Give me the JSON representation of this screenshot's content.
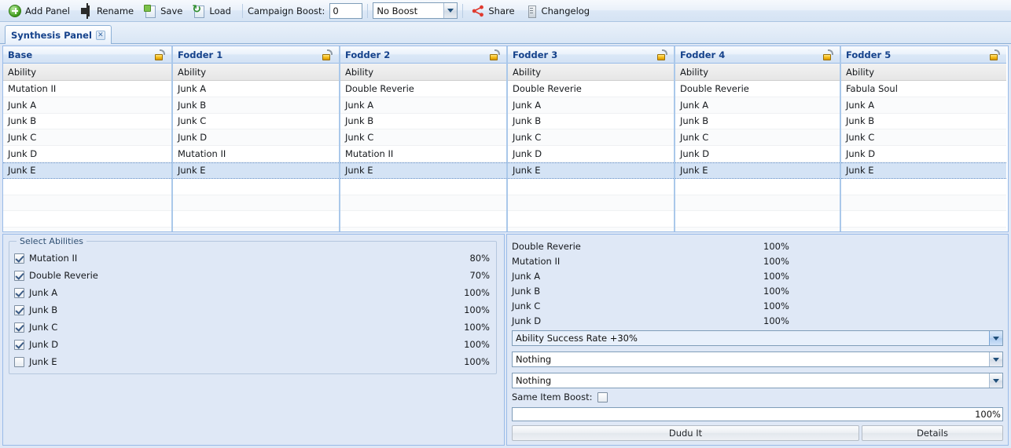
{
  "toolbar": {
    "add_panel": "Add Panel",
    "rename": "Rename",
    "save": "Save",
    "load": "Load",
    "campaign_boost_label": "Campaign Boost:",
    "campaign_boost_value": "0",
    "boost_select_value": "No Boost",
    "share": "Share",
    "changelog": "Changelog"
  },
  "tabs": [
    {
      "label": "Synthesis Panel",
      "close": "✕"
    }
  ],
  "grid": {
    "sub_header": "Ability",
    "columns": [
      {
        "title": "Base",
        "lock": "unlocked-padlock-icon",
        "rows": [
          "Mutation II",
          "Junk A",
          "Junk B",
          "Junk C",
          "Junk D",
          "Junk E"
        ],
        "selected_index": 5
      },
      {
        "title": "Fodder 1",
        "lock": "unlocked-padlock-icon",
        "rows": [
          "Junk A",
          "Junk B",
          "Junk C",
          "Junk D",
          "Mutation II",
          "Junk E"
        ],
        "selected_index": 5
      },
      {
        "title": "Fodder 2",
        "lock": "unlocked-padlock-icon",
        "rows": [
          "Double Reverie",
          "Junk A",
          "Junk B",
          "Junk C",
          "Mutation II",
          "Junk E"
        ],
        "selected_index": 5
      },
      {
        "title": "Fodder 3",
        "lock": "unlocked-padlock-icon",
        "rows": [
          "Double Reverie",
          "Junk A",
          "Junk B",
          "Junk C",
          "Junk D",
          "Junk E"
        ],
        "selected_index": 5
      },
      {
        "title": "Fodder 4",
        "lock": "unlocked-padlock-icon",
        "rows": [
          "Double Reverie",
          "Junk A",
          "Junk B",
          "Junk C",
          "Junk D",
          "Junk E"
        ],
        "selected_index": 5
      },
      {
        "title": "Fodder 5",
        "lock": "unlocked-padlock-icon",
        "rows": [
          "Fabula Soul",
          "Junk A",
          "Junk B",
          "Junk C",
          "Junk D",
          "Junk E"
        ],
        "selected_index": 5
      }
    ],
    "empty_rows": 4
  },
  "select_abilities": {
    "legend": "Select Abilities",
    "items": [
      {
        "name": "Mutation II",
        "checked": true,
        "percent": "80%"
      },
      {
        "name": "Double Reverie",
        "checked": true,
        "percent": "70%"
      },
      {
        "name": "Junk A",
        "checked": true,
        "percent": "100%"
      },
      {
        "name": "Junk B",
        "checked": true,
        "percent": "100%"
      },
      {
        "name": "Junk C",
        "checked": true,
        "percent": "100%"
      },
      {
        "name": "Junk D",
        "checked": true,
        "percent": "100%"
      },
      {
        "name": "Junk E",
        "checked": false,
        "percent": "100%"
      }
    ]
  },
  "results": {
    "rows": [
      {
        "name": "Double Reverie",
        "percent": "100%"
      },
      {
        "name": "Mutation II",
        "percent": "100%"
      },
      {
        "name": "Junk A",
        "percent": "100%"
      },
      {
        "name": "Junk B",
        "percent": "100%"
      },
      {
        "name": "Junk C",
        "percent": "100%"
      },
      {
        "name": "Junk D",
        "percent": "100%"
      }
    ],
    "combos": [
      {
        "value": "Ability Success Rate +30%",
        "focused": true
      },
      {
        "value": "Nothing",
        "focused": false
      },
      {
        "value": "Nothing",
        "focused": false
      }
    ],
    "same_item_boost_label": "Same Item Boost:",
    "same_item_boost_checked": false,
    "total_percent": "100%",
    "dudu_button": "Dudu It",
    "details_button": "Details"
  },
  "colors": {
    "accent": "#15428b",
    "panel_bg": "#dfe8f6",
    "grid_border": "#99bbe8",
    "selection": "#d4e3f5",
    "lock_gold": "#f5bb16"
  }
}
